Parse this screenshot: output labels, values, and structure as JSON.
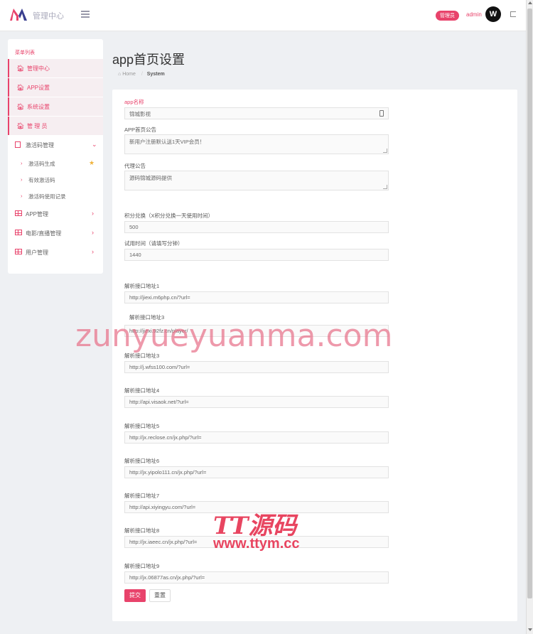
{
  "header": {
    "brand": "管理中心",
    "badge": "管理员",
    "username": "admin",
    "avatar_letter": "W"
  },
  "sidebar": {
    "title": "菜单列表",
    "items": [
      {
        "label": "管理中心",
        "icon": "home-icon"
      },
      {
        "label": "APP设置",
        "icon": "home-icon"
      },
      {
        "label": "系统设置",
        "icon": "home-icon"
      },
      {
        "label": "管 理 员",
        "icon": "home-icon"
      },
      {
        "label": "激活码管理",
        "icon": "document-icon",
        "arrow": "⌄"
      },
      {
        "label": "激活码生成",
        "star": "★"
      },
      {
        "label": "有效激活码"
      },
      {
        "label": "激活码使用记录"
      },
      {
        "label": "APP管理",
        "icon": "grid-icon",
        "arrow": "›"
      },
      {
        "label": "电影/直播管理",
        "icon": "grid-icon",
        "arrow": "›"
      },
      {
        "label": "用户管理",
        "icon": "grid-icon",
        "arrow": "›"
      }
    ]
  },
  "page": {
    "title": "app首页设置",
    "breadcrumb_home": "Home",
    "breadcrumb_current": "System"
  },
  "form": {
    "app_name_label": "app名称",
    "app_name_value": "锦城影视",
    "notice_label": "APP首页公告",
    "notice_value": "新用户注册默认送1天VIP会员！",
    "agent_label": "代理公告",
    "agent_value": "源码锦城源码提供",
    "points_label": "积分兑换（X积分兑换一天使用时间）",
    "points_value": "500",
    "trial_label": "试用时间（请填写分钟）",
    "trial_value": "1440",
    "apis": [
      {
        "label": "解析接口地址1",
        "value": "http://jiexi.m6php.cn/?url="
      },
      {
        "label": "解析接口地址3",
        "value": "http://jiexi.92fz.cn/player/"
      },
      {
        "label": "解析接口地址3",
        "value": "http://j.wfss100.com/?url="
      },
      {
        "label": "解析接口地址4",
        "value": "http://api.visaok.net/?url="
      },
      {
        "label": "解析接口地址5",
        "value": "http://jx.reclose.cn/jx.php/?url="
      },
      {
        "label": "解析接口地址6",
        "value": "http://jx.yipolo111.cn/jx.php/?url="
      },
      {
        "label": "解析接口地址7",
        "value": "http://api.xiyingyu.com/?url="
      },
      {
        "label": "解析接口地址8",
        "value": "http://jx.iaeec.cn/jx.php/?url="
      },
      {
        "label": "解析接口地址9",
        "value": "http://jx.06877as.cn/jx.php/?url="
      }
    ],
    "submit_label": "提交",
    "reset_label": "重置"
  },
  "watermarks": {
    "site1": "zunyueyuanma.com",
    "brand2": "TT源码",
    "site2": "www.ttym.cc"
  },
  "colors": {
    "accent": "#e8436b",
    "background": "#eef0f3"
  }
}
